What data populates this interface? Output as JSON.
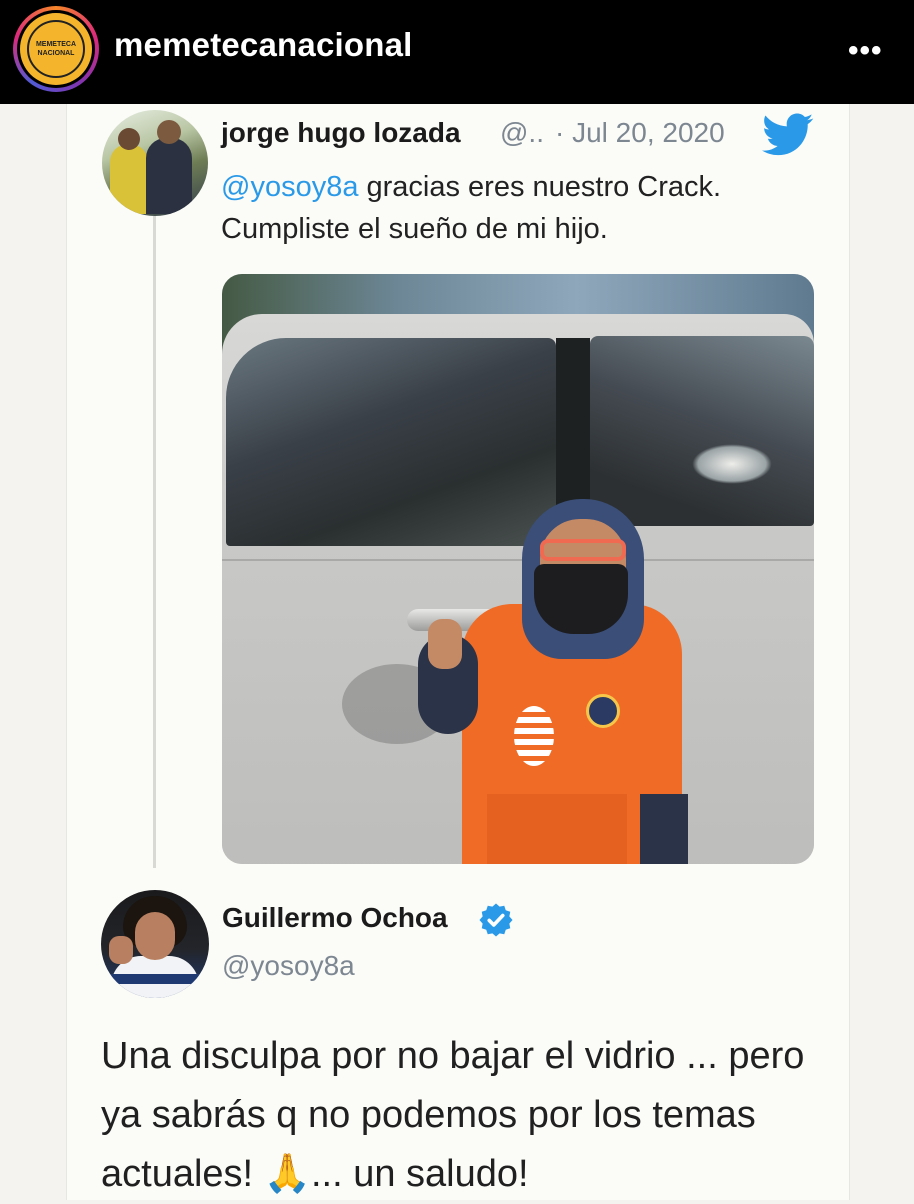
{
  "instagram": {
    "username": "memetecanacional",
    "avatar_text_line1": "MEMETECA",
    "avatar_text_line2": "NACIONAL",
    "more_icon": "more-horizontal-icon",
    "more_glyph": "•••"
  },
  "tweet1": {
    "author_name": "jorge hugo lozada",
    "author_handle": "@..",
    "date": "· Jul 20, 2020",
    "mention": "@yosoy8a",
    "text_rest": " gracias eres nuestro Crack. Cumpliste el sueño de mi hijo.",
    "bird_icon": "twitter-bird-icon",
    "photo_icon": "photo-boy-by-car"
  },
  "tweet2": {
    "author_name": "Guillermo Ochoa",
    "author_handle": "@yosoy8a",
    "text_part1": "Una disculpa por no bajar el vidrio ... pero ya sabrás q no podemos por los temas actuales! ",
    "emoji": "🙏",
    "text_part2": "... un saludo!",
    "verified_icon": "verified-badge-icon"
  },
  "colors": {
    "instagram_bar": "#000000",
    "twitter_blue": "#2a9ae8",
    "muted_text": "#7d8791"
  }
}
